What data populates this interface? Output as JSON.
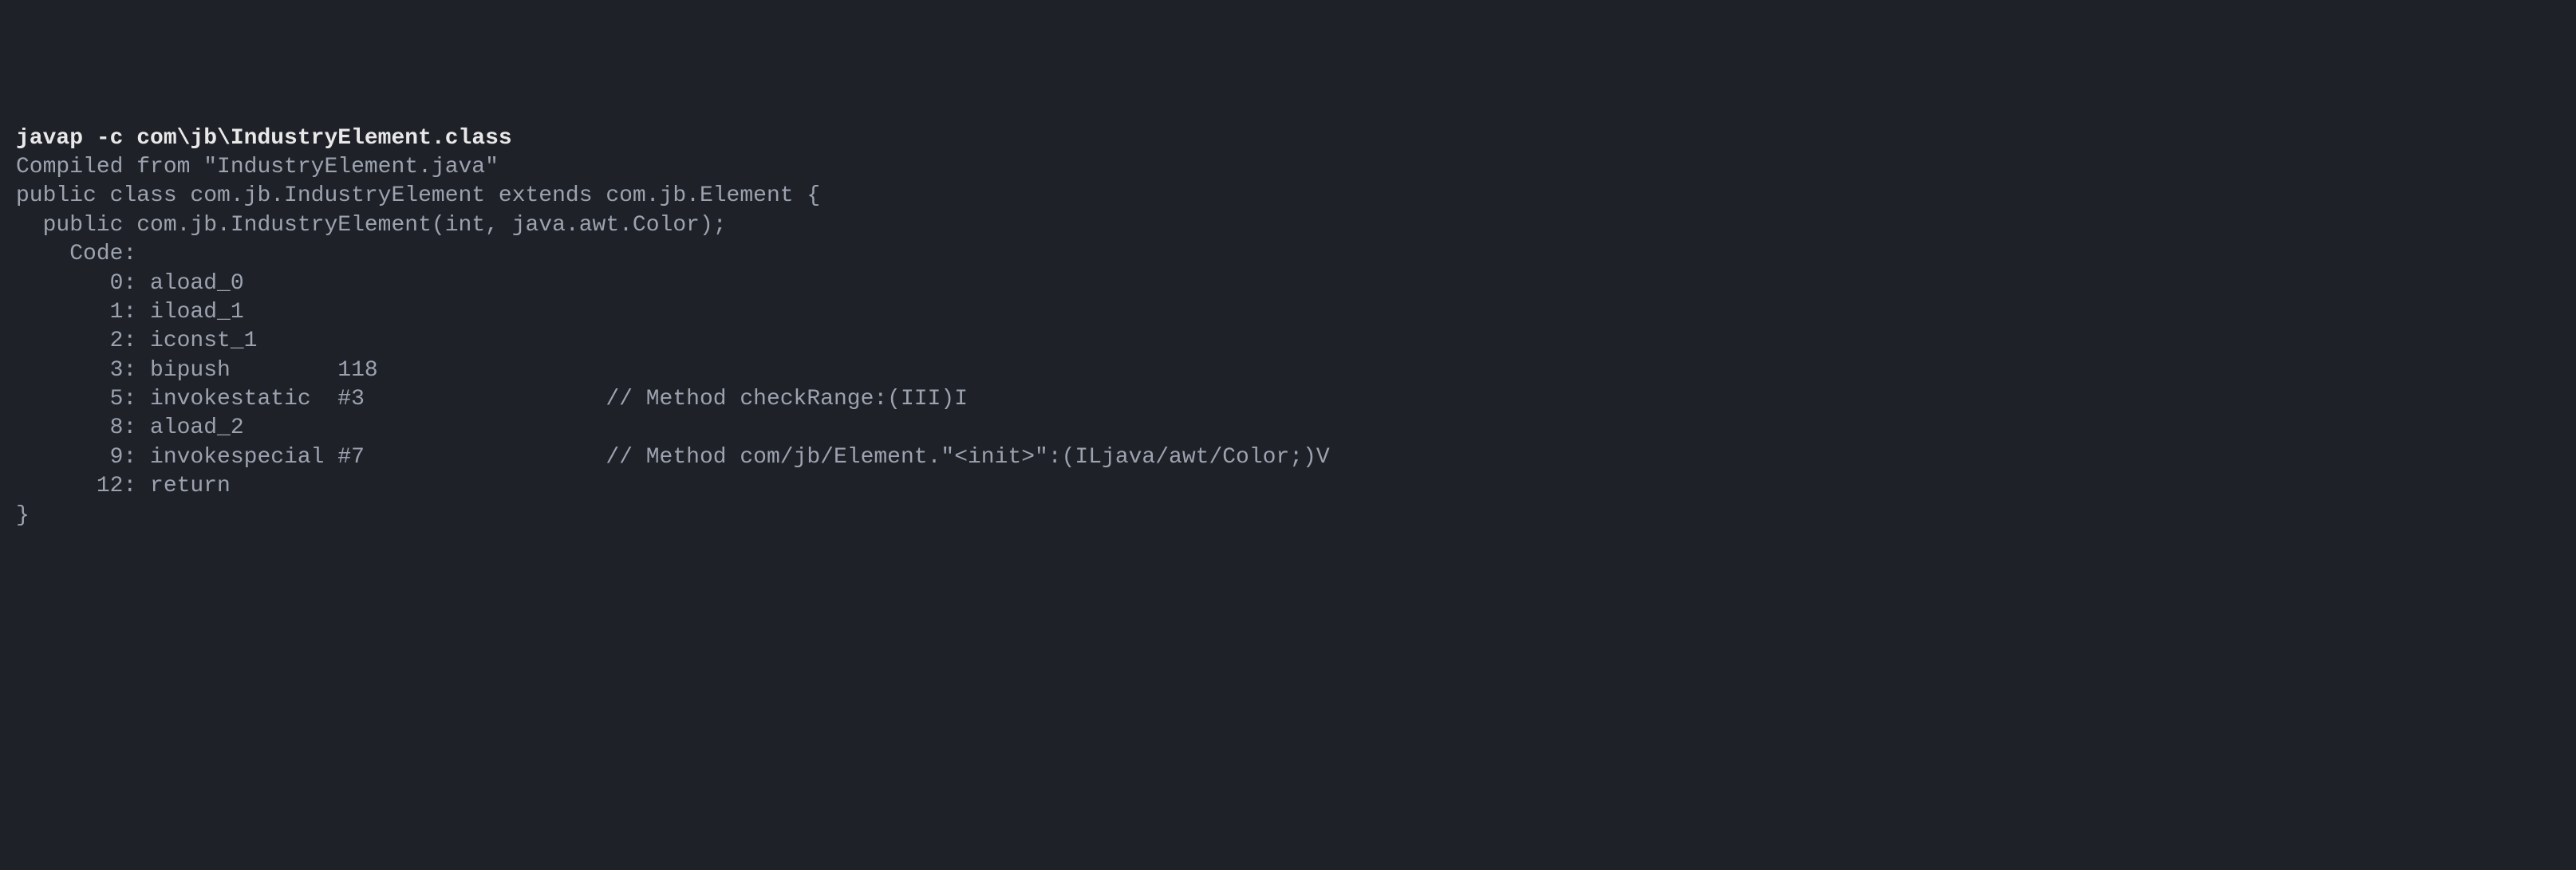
{
  "terminal": {
    "command": "javap -c com\\jb\\IndustryElement.class",
    "lines": [
      "Compiled from \"IndustryElement.java\"",
      "public class com.jb.IndustryElement extends com.jb.Element {",
      "  public com.jb.IndustryElement(int, java.awt.Color);",
      "    Code:",
      "       0: aload_0",
      "       1: iload_1",
      "       2: iconst_1",
      "       3: bipush        118",
      "       5: invokestatic  #3                  // Method checkRange:(III)I",
      "       8: aload_2",
      "       9: invokespecial #7                  // Method com/jb/Element.\"<init>\":(ILjava/awt/Color;)V",
      "      12: return",
      "}"
    ]
  }
}
